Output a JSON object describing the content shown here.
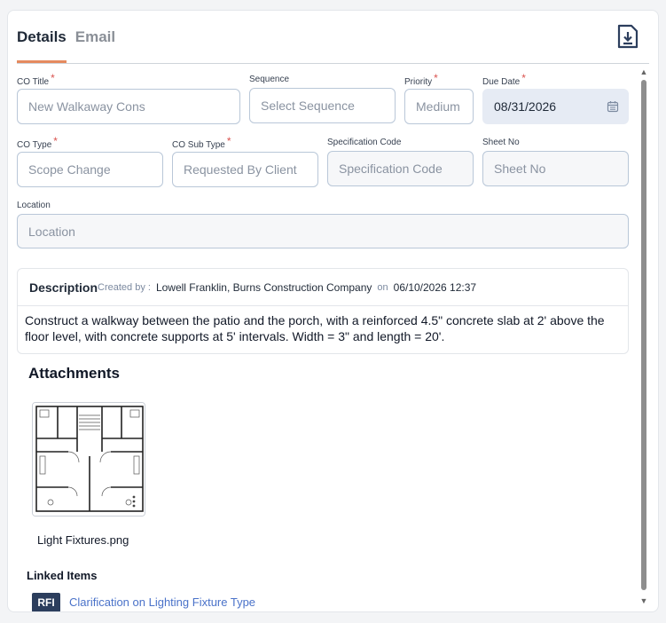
{
  "tabs": [
    {
      "label": "Details",
      "active": true
    },
    {
      "label": "Email",
      "active": false
    }
  ],
  "header": {
    "download_icon": "download-icon"
  },
  "fields": {
    "co_title": {
      "label": "CO Title",
      "required": "*",
      "value": "New Walkaway Cons"
    },
    "sequence": {
      "label": "Sequence",
      "placeholder": "Select Sequence"
    },
    "priority": {
      "label": "Priority",
      "required": "*",
      "placeholder": "Medium"
    },
    "due_date": {
      "label": "Due Date",
      "required": "*",
      "value": "08/31/2026"
    },
    "co_type": {
      "label": "CO Type",
      "required": "*",
      "value": "Scope Change"
    },
    "co_sub_type": {
      "label": "CO Sub Type",
      "required": "*",
      "value": "Requested By Client"
    },
    "spec_code": {
      "label": "Specification Code",
      "placeholder": "Specification Code"
    },
    "sheet_no": {
      "label": "Sheet No",
      "placeholder": "Sheet No"
    },
    "location": {
      "label": "Location",
      "placeholder": "Location"
    }
  },
  "description": {
    "title": "Description",
    "created_by_label": "Created by :",
    "created_by": "Lowell Franklin, Burns Construction Company",
    "on_label": "on",
    "created_on": "06/10/2026 12:37",
    "text": "Construct a walkway between the patio and the porch, with a reinforced 4.5\" concrete slab at 2' above the floor level, with concrete supports at 5' intervals. Width = 3\" and length = 20'."
  },
  "attachments": {
    "title": "Attachments",
    "items": [
      {
        "name": "Light Fixtures.png"
      }
    ]
  },
  "linked_items": {
    "title": "Linked Items",
    "items": [
      {
        "badge": "RFI",
        "label": "Clarification on Lighting Fixture Type"
      }
    ]
  },
  "colors": {
    "accent": "#e58a5f",
    "link": "#4a72c9",
    "badge_bg": "#2c3e5d",
    "required": "#d9534f"
  }
}
